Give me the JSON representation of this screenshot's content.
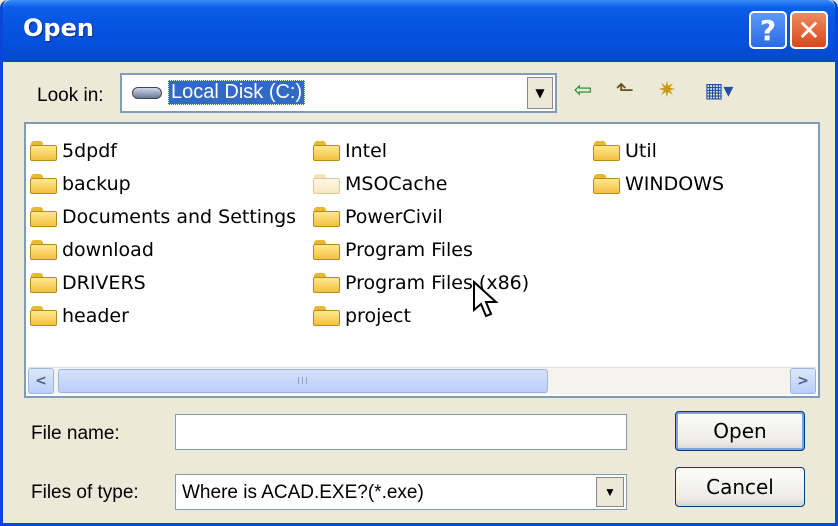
{
  "window": {
    "title": "Open"
  },
  "titlebar": {
    "help_label": "?",
    "close_label": "✕"
  },
  "lookin": {
    "label": "Look in:",
    "value": "Local Disk (C:)"
  },
  "toolbar": {
    "back_glyph": "⇦",
    "up_glyph": "⬑",
    "newfolder_glyph": "✷",
    "views_glyph": "▦▾"
  },
  "files": [
    {
      "name": "5dpdf"
    },
    {
      "name": "backup"
    },
    {
      "name": "Documents and Settings"
    },
    {
      "name": "download"
    },
    {
      "name": "DRIVERS"
    },
    {
      "name": "header"
    },
    {
      "name": "Intel"
    },
    {
      "name": "MSOCache"
    },
    {
      "name": "PowerCivil"
    },
    {
      "name": "Program Files"
    },
    {
      "name": "Program Files (x86)"
    },
    {
      "name": "project"
    },
    {
      "name": "Util"
    },
    {
      "name": "WINDOWS"
    }
  ],
  "scrollbar": {
    "left_glyph": "<",
    "right_glyph": ">",
    "thumb_glyph": "III"
  },
  "filename": {
    "label": "File name:",
    "value": ""
  },
  "filetype": {
    "label": "Files of type:",
    "value": "Where is ACAD.EXE?(*.exe)"
  },
  "buttons": {
    "open_label": "Open",
    "cancel_label": "Cancel"
  },
  "colors": {
    "titlebar": "#0654e0",
    "selection": "#316ac5",
    "face": "#ece9d8"
  }
}
